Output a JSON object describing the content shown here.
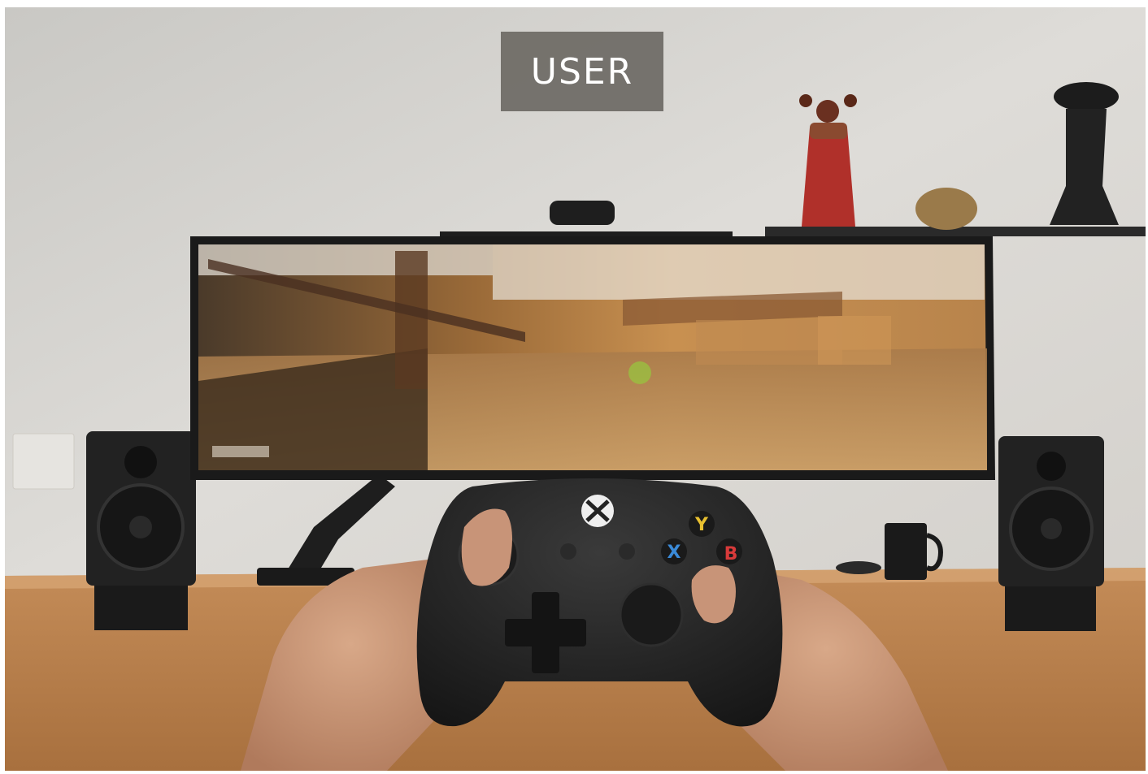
{
  "hero": {
    "label": "USER",
    "controller_buttons": {
      "y": "Y",
      "x": "X",
      "b": "B"
    }
  },
  "colors": {
    "label_bg": "#6c6964",
    "label_text": "#ffffff",
    "wall": "#d8d6d2",
    "desk": "#b67a44",
    "controller": "#222222"
  }
}
